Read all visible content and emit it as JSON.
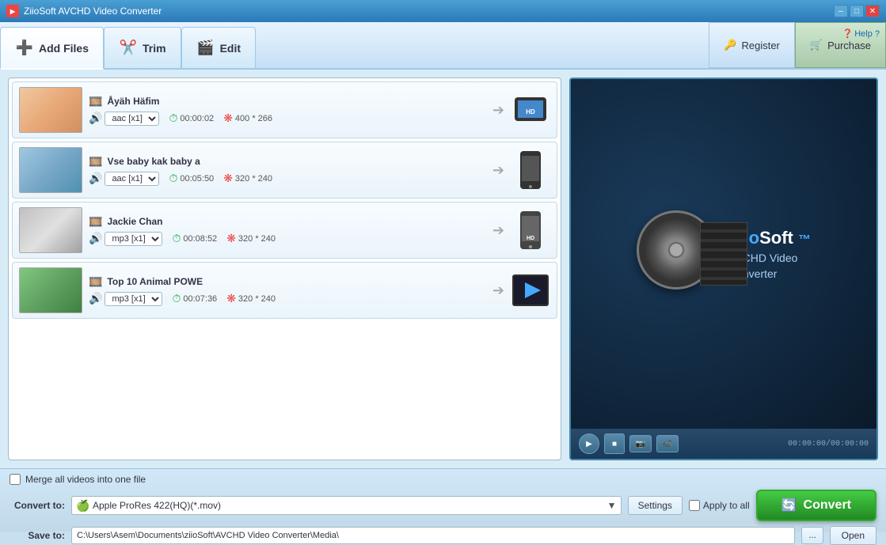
{
  "app": {
    "title": "ZiioSoft AVCHD Video Converter",
    "help_label": "Help"
  },
  "titlebar": {
    "minimize": "–",
    "maximize": "□",
    "close": "✕"
  },
  "toolbar": {
    "add_files": "Add Files",
    "trim": "Trim",
    "edit": "Edit",
    "register": "Register",
    "purchase": "Purchase",
    "help": "Help ?"
  },
  "files": [
    {
      "name": "Åyäh Häfim",
      "audio": "aac [x1]",
      "duration": "00:00:02",
      "size": "400 * 266",
      "thumb_class": "thumb-1",
      "target": "📱",
      "target_label": "iPad HD"
    },
    {
      "name": "Vse baby kak baby a",
      "audio": "aac [x1]",
      "duration": "00:05:50",
      "size": "320 * 240",
      "thumb_class": "thumb-2",
      "target": "📱",
      "target_label": "iPhone"
    },
    {
      "name": "Jackie Chan",
      "audio": "mp3 [x1]",
      "duration": "00:08:52",
      "size": "320 * 240",
      "thumb_class": "thumb-3",
      "target": "📱",
      "target_label": "iPhone HD"
    },
    {
      "name": "Top 10 Animal POWE",
      "audio": "mp3 [x1]",
      "duration": "00:07:36",
      "size": "320 * 240",
      "thumb_class": "thumb-4",
      "target": "🎬",
      "target_label": "FinalCut"
    }
  ],
  "preview": {
    "brand": "ZiioSoft",
    "product": "AVCHD Video Converter",
    "time": "00:00:00/00:00:00"
  },
  "bottom": {
    "merge_label": "Merge all videos into one file",
    "convert_to_label": "Convert to:",
    "save_to_label": "Save to:",
    "format": "Apple ProRes 422(HQ)(*.mov)",
    "settings_label": "Settings",
    "apply_all_label": "Apply to all",
    "convert_label": "Convert",
    "save_path": "C:\\Users\\Asem\\Documents\\ziioSoft\\AVCHD Video Converter\\Media\\",
    "browse_label": "...",
    "open_label": "Open"
  }
}
